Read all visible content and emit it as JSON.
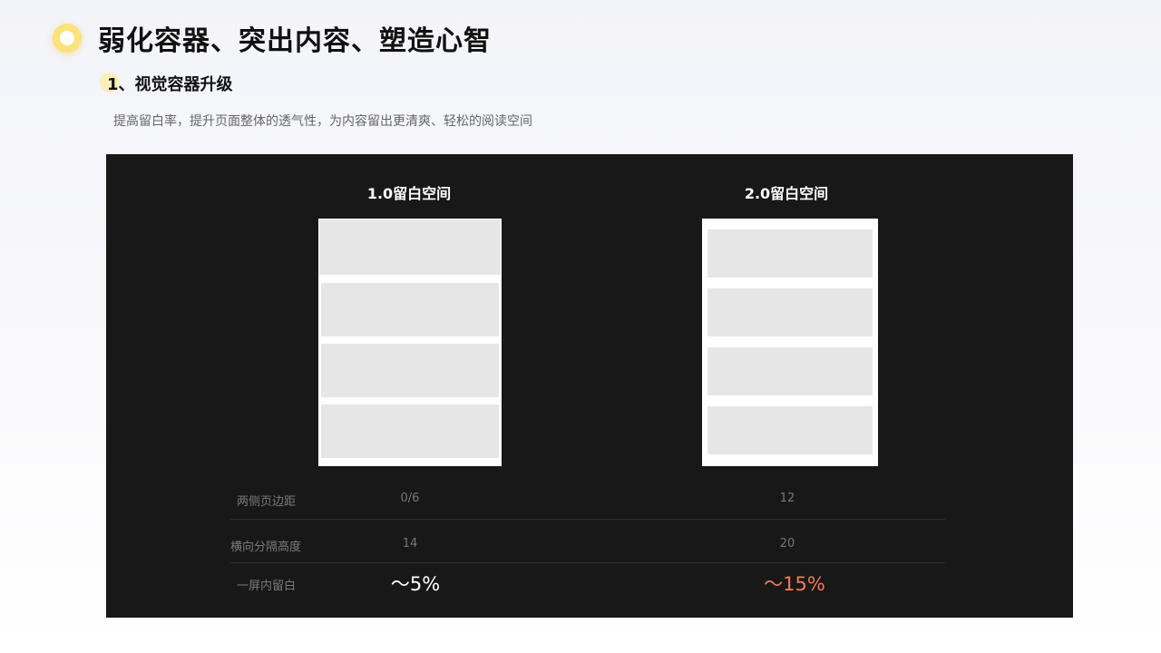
{
  "header": {
    "title": "弱化容器、突出内容、塑造心智",
    "section": "1、视觉容器升级",
    "description": "提高留白率，提升页面整体的透气性，为内容留出更清爽、轻松的阅读空间"
  },
  "comparison": {
    "left_title": "1.0留白空间",
    "right_title": "2.0留白空间",
    "rows": [
      {
        "label": "两侧页边距",
        "v1": "0/6",
        "v2": "12"
      },
      {
        "label": "横向分隔高度",
        "v1": "14",
        "v2": "20"
      },
      {
        "label": "一屏内留白",
        "v1": "～5%",
        "v2": "～15%"
      }
    ]
  },
  "colors": {
    "accent_yellow": "#fbe27a",
    "panel_bg": "#181818",
    "highlight": "#f47a55"
  }
}
